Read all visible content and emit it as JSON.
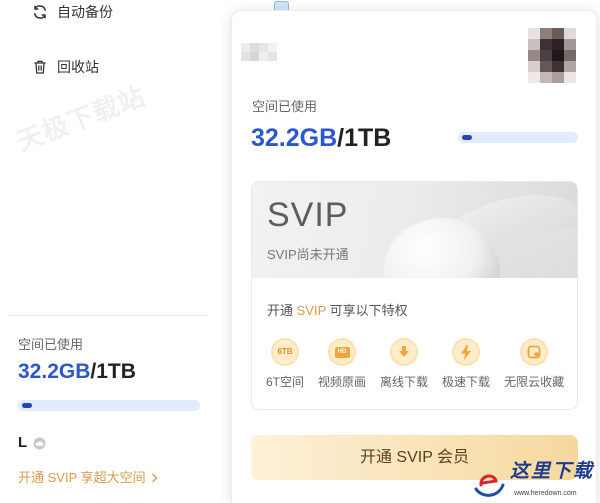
{
  "sidebar": {
    "items": [
      {
        "label": "自动备份",
        "icon": "sync-icon"
      },
      {
        "label": "回收站",
        "icon": "trash-icon"
      }
    ],
    "watermark_text": "天极下载站",
    "storage": {
      "label": "空间已使用",
      "used": "32.2GB",
      "total": "/1TB",
      "used_percent": 3.1
    },
    "user": {
      "name": "L",
      "badge_icon": "cloud-badge-icon"
    },
    "upgrade_link": {
      "label": "开通 SVIP 享超大空间",
      "icon": "chevron-right-icon"
    }
  },
  "popup": {
    "avatar_icon": "avatar",
    "storage": {
      "label": "空间已使用",
      "used": "32.2GB",
      "total": "/1TB",
      "used_percent": 3.1
    },
    "svip_card": {
      "title": "SVIP",
      "status": "SVIP尚未开通",
      "benefits_intro": {
        "prefix": "开通 ",
        "highlight": "SVIP",
        "suffix": " 可享以下特权"
      },
      "benefits": [
        {
          "icon": "6tb-storage-icon",
          "badge": "6TB",
          "label": "6T空间"
        },
        {
          "icon": "hd-video-icon",
          "badge": "HD",
          "label": "视频原画"
        },
        {
          "icon": "offline-download-icon",
          "label": "离线下载"
        },
        {
          "icon": "lightning-icon",
          "label": "极速下载"
        },
        {
          "icon": "cloud-favorite-icon",
          "label": "无限云收藏"
        }
      ]
    },
    "cta_button": {
      "label": "开通 SVIP 会员"
    }
  },
  "site_watermark": {
    "name": "这里下载",
    "url": "www.heredown.com",
    "icon": "swirl-logo-icon"
  },
  "colors": {
    "storage_blue": "#2b57cf",
    "progress_fill": "#2545b8",
    "progress_track": "#e4ecfb",
    "svip_gold": "#d89c4a",
    "cta_gradient_start": "#fdf1d8",
    "cta_gradient_end": "#f6d89e"
  }
}
